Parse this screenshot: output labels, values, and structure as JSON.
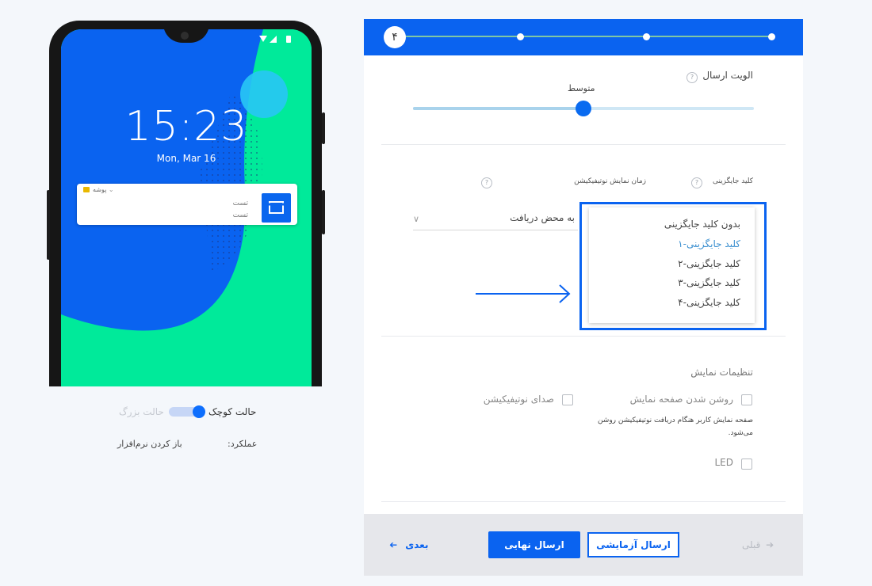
{
  "phone": {
    "time": "15:23",
    "date": "Mon, Mar 16",
    "notification": {
      "app_name": "پوشه",
      "title": "تست",
      "body": "تست"
    }
  },
  "preview": {
    "mode_big": "حالت بزرگ",
    "mode_small": "حالت کوچک",
    "mode_small_selected": true,
    "action_label": "عملکرد:",
    "action_value": "باز کردن نرم‌افزار"
  },
  "stepper": {
    "current_step": "۴",
    "total_steps": 4
  },
  "priority": {
    "label": "الویت ارسال",
    "value": "متوسط",
    "position_fraction": 0.5
  },
  "collapse_key": {
    "label": "کلید جایگزینی",
    "options": [
      "بدون کلید جایگزینی",
      "کلید جایگزینی-۱",
      "کلید جایگزینی-۲",
      "کلید جایگزینی-۳",
      "کلید جایگزینی-۴"
    ],
    "highlighted_index": 1
  },
  "display_time": {
    "label": "زمان نمایش نوتیفیکیشن",
    "value": "به محض دریافت"
  },
  "display_settings": {
    "title": "تنظیمات نمایش",
    "screen_on_label": "روشن شدن صفحه نمایش",
    "screen_on_note": "صفحه نمایش کاربر هنگام دریافت نوتیفیکیشن روشن می‌شود.",
    "sound_label": "صدای نوتیفیکیشن",
    "led_label": "LED"
  },
  "footer": {
    "prev_label": "قبلی",
    "test_label": "ارسال آزمایشی",
    "final_label": "ارسال نهایی",
    "next_label": "بعدی"
  },
  "colors": {
    "accent": "#0a63f0",
    "phone_green": "#00ea9a",
    "phone_blue": "#0a63f0"
  }
}
